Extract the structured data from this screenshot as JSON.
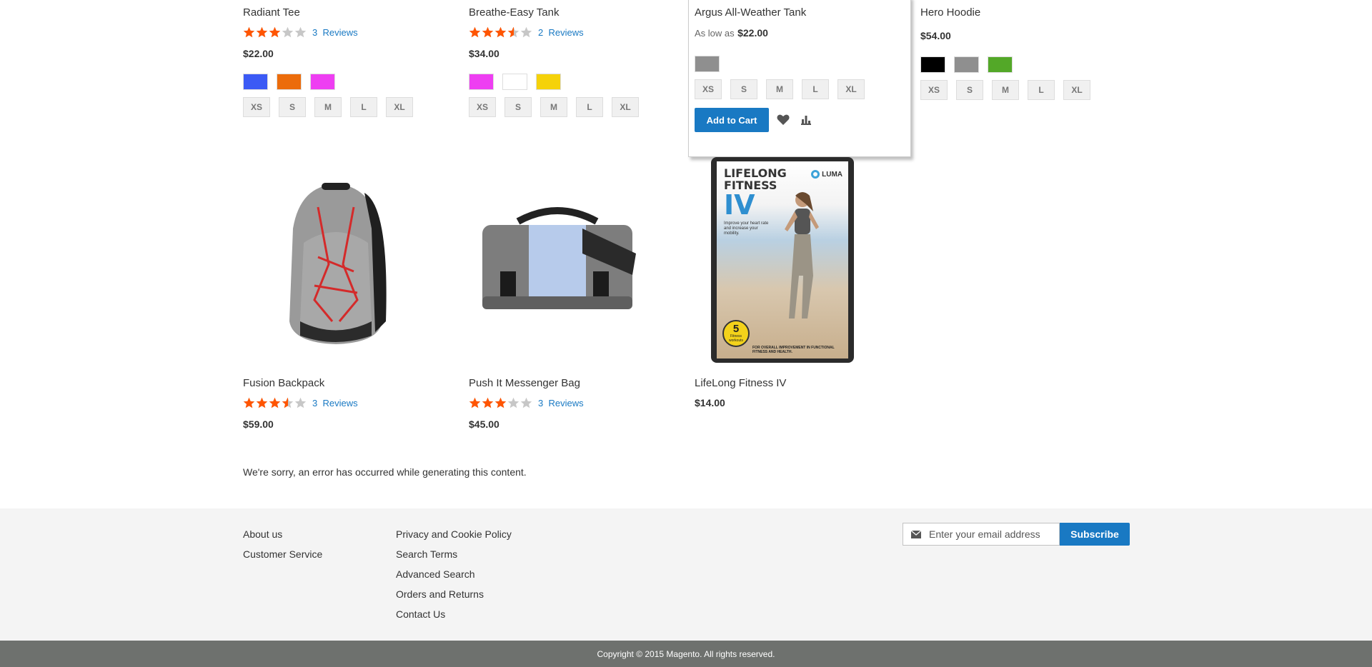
{
  "products_row1": [
    {
      "name": "Radiant Tee",
      "rating": 0.6,
      "reviews_count": "3",
      "reviews_label": "Reviews",
      "price": "$22.00",
      "colors": [
        "#3b5af5",
        "#ec6c0b",
        "#ee3ef2"
      ],
      "sizes": [
        "XS",
        "S",
        "M",
        "L",
        "XL"
      ]
    },
    {
      "name": "Breathe-Easy Tank",
      "rating": 0.7,
      "reviews_count": "2",
      "reviews_label": "Reviews",
      "price": "$34.00",
      "colors": [
        "#ee3ef2",
        "#ffffff",
        "#f5d20a"
      ],
      "sizes": [
        "XS",
        "S",
        "M",
        "L",
        "XL"
      ]
    },
    {
      "name": "Argus All-Weather Tank",
      "as_low_as_label": "As low as",
      "price": "$22.00",
      "colors": [
        "#8f8f8f"
      ],
      "sizes": [
        "XS",
        "S",
        "M",
        "L",
        "XL"
      ],
      "add_to_cart_label": "Add to Cart"
    },
    {
      "name": "Hero Hoodie",
      "price": "$54.00",
      "colors": [
        "#000000",
        "#8f8f8f",
        "#53a828"
      ],
      "sizes": [
        "XS",
        "S",
        "M",
        "L",
        "XL"
      ]
    }
  ],
  "products_row2": [
    {
      "name": "Fusion Backpack",
      "rating": 0.7,
      "reviews_count": "3",
      "reviews_label": "Reviews",
      "price": "$59.00"
    },
    {
      "name": "Push It Messenger Bag",
      "rating": 0.6,
      "reviews_count": "3",
      "reviews_label": "Reviews",
      "price": "$45.00"
    },
    {
      "name": "LifeLong Fitness IV",
      "price": "$14.00",
      "cover": {
        "line1": "LIFELONG",
        "line2": "FITNESS",
        "line3": "IV",
        "brand": "LUMA",
        "tagline": "Improve your heart rate and increase your mobility.",
        "badge_num": "5",
        "badge_text": "Fitness workouts",
        "bottom": "FOR OVERALL IMPROVEMENT IN FUNCTIONAL FITNESS AND HEALTH."
      }
    }
  ],
  "error_message": "We're sorry, an error has occurred while generating this content.",
  "footer": {
    "col1": [
      "About us",
      "Customer Service"
    ],
    "col2": [
      "Privacy and Cookie Policy",
      "Search Terms",
      "Advanced Search",
      "Orders and Returns",
      "Contact Us"
    ],
    "email_placeholder": "Enter your email address",
    "subscribe_label": "Subscribe",
    "copyright": "Copyright © 2015 Magento. All rights reserved."
  },
  "colors": {
    "accent": "#1979c3",
    "star": "#ff5501",
    "star_empty": "#c7c7c7"
  }
}
